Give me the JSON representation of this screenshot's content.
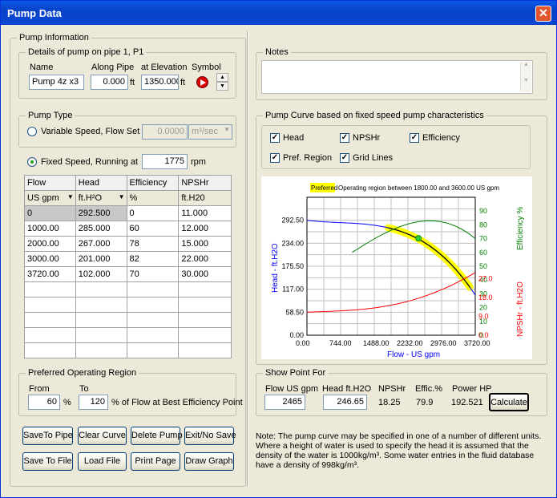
{
  "window": {
    "title": "Pump Data",
    "close_glyph": "✕"
  },
  "pump_info": {
    "group_label": "Pump Information",
    "details": {
      "label": "Details of pump on pipe 1, P1",
      "name_label": "Name",
      "name_value": "Pump 4z x3",
      "along_label": "Along Pipe",
      "along_value": "0.000",
      "along_unit": "ft",
      "elev_label": "at Elevation",
      "elev_value": "1350.000",
      "elev_unit": "ft",
      "symbol_label": "Symbol"
    },
    "pump_type": {
      "label": "Pump Type",
      "variable_label": "Variable Speed, Flow Set to",
      "variable_value": "0.0000",
      "variable_unit": "m³/sec",
      "fixed_label": "Fixed Speed,  Running at",
      "fixed_value": "1775",
      "fixed_unit": "rpm"
    }
  },
  "table": {
    "headers": [
      "Flow",
      "Head",
      "Efficiency",
      "NPSHr"
    ],
    "units": [
      "US gpm",
      "ft.H²O",
      "%",
      "ft.H20"
    ],
    "rows": [
      [
        "0",
        "292.500",
        "0",
        "11.000"
      ],
      [
        "1000.00",
        "285.000",
        "60",
        "12.000"
      ],
      [
        "2000.00",
        "267.000",
        "78",
        "15.000"
      ],
      [
        "3000.00",
        "201.000",
        "82",
        "22.000"
      ],
      [
        "3720.00",
        "102.000",
        "70",
        "30.000"
      ]
    ]
  },
  "preferred": {
    "label": "Preferred Operating Region",
    "from_label": "From",
    "from_value": "60",
    "pct1": "%",
    "to_label": "To",
    "to_value": "120",
    "to_suffix": "% of Flow at Best Efficiency Point"
  },
  "buttons": {
    "save_to_pipe": "SaveTo Pipe",
    "clear_curve": "Clear Curve",
    "delete_pump": "Delete Pump",
    "exit_no_save": "Exit/No Save",
    "save_to_file": "Save To File",
    "load_file": "Load File",
    "print_page": "Print Page",
    "draw_graph": "Draw Graph",
    "calculate": "Calculate"
  },
  "notes": {
    "label": "Notes",
    "value": ""
  },
  "curve": {
    "label": "Pump Curve based on fixed speed pump characteristics",
    "checks": {
      "head": "Head",
      "npshr": "NPSHr",
      "efficiency": "Efficiency",
      "pref_region": "Pref. Region",
      "grid_lines": "Grid Lines"
    },
    "check_mark": "✓"
  },
  "chart_data": {
    "type": "line",
    "title": "Operating region between 1800.00 and 3600.00 US gpm",
    "legend_tag": "Preferred",
    "xlabel": "Flow - US gpm",
    "ylabel_left": "Head - ft.H2O",
    "ylabel_eff": "Efficiency %",
    "ylabel_npsh": "NPSHr - ft.H2O",
    "x_ticks": [
      "0.00",
      "744.00",
      "1488.00",
      "2232.00",
      "2976.00",
      "3720.00"
    ],
    "y_ticks_head": [
      "0.00",
      "58.50",
      "117.00",
      "175.50",
      "234.00",
      "292.50"
    ],
    "y_ticks_eff": [
      "0",
      "10",
      "20",
      "30",
      "40",
      "50",
      "60",
      "70",
      "80",
      "90"
    ],
    "y_ticks_npsh": [
      "0.0",
      "9.0",
      "18.0",
      "27.0"
    ],
    "xlim": [
      0,
      3720
    ],
    "head_ylim": [
      0,
      351
    ],
    "head": {
      "x": [
        0,
        1000,
        2000,
        3000,
        3720
      ],
      "y": [
        292.5,
        285,
        267,
        201,
        102
      ],
      "color": "#0000ff"
    },
    "efficiency": {
      "x": [
        1000,
        2000,
        3000,
        3720
      ],
      "y": [
        60,
        78,
        82,
        70
      ],
      "color": "#008000",
      "ylim": [
        0,
        100
      ]
    },
    "npshr": {
      "x": [
        0,
        1000,
        2000,
        3000,
        3720
      ],
      "y": [
        11,
        12,
        15,
        22,
        30
      ],
      "color": "#ff0000",
      "ylim": [
        0,
        66
      ]
    },
    "preferred_range": [
      1800,
      3600
    ],
    "point": {
      "x": 2465,
      "y": 246.65
    }
  },
  "show_point": {
    "label": "Show Point For",
    "flow_label": "Flow US gpm",
    "flow_value": "2465",
    "head_label": "Head ft.H2O",
    "head_value": "246.65",
    "npshr_label": "NPSHr",
    "npshr_value": "18.25",
    "eff_label": "Effic.%",
    "eff_value": "79.9",
    "power_label": "Power HP",
    "power_value": "192.521"
  },
  "note_text": "Note: The pump curve may be specified in one of a number of different units. Where a height of water is used to specify the head it is assumed that the density of the water is 1000kg/m³. Some water entries in the fluid database have a density of 998kg/m³."
}
